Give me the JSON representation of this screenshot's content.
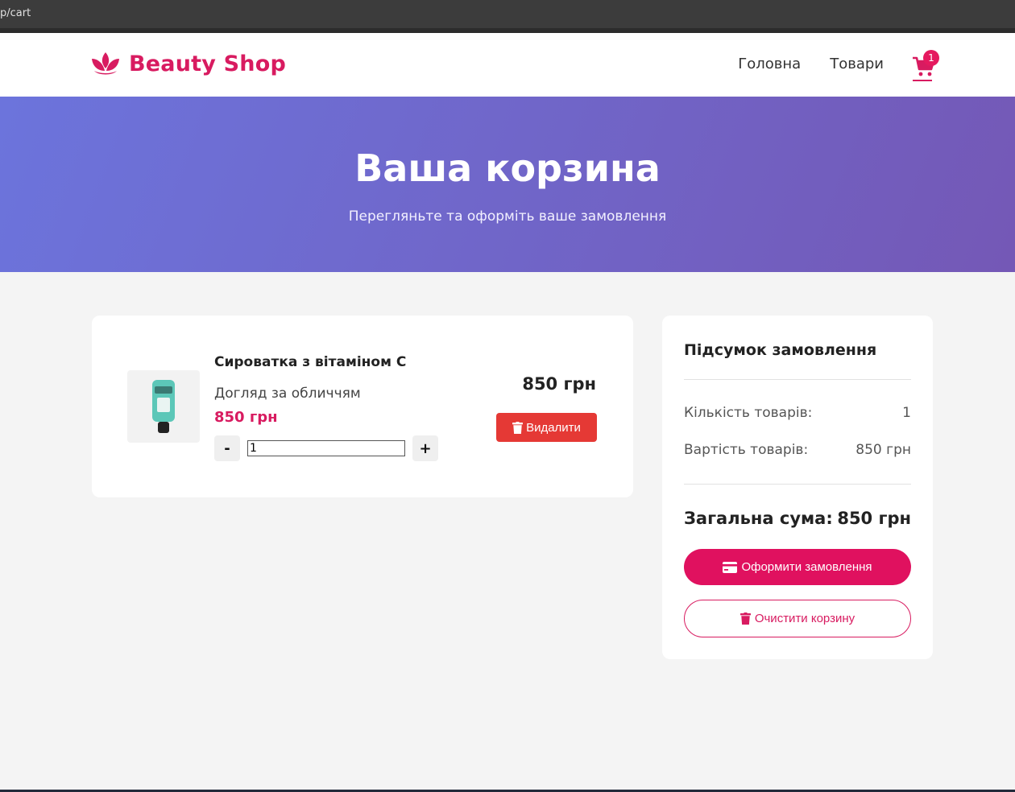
{
  "browser": {
    "url": "p/cart"
  },
  "header": {
    "brand": "Beauty Shop",
    "nav": [
      {
        "label": "Головна"
      },
      {
        "label": "Товари"
      }
    ],
    "cart_count": "1",
    "brand_color": "#d81b60"
  },
  "hero": {
    "title": "Ваша корзина",
    "subtitle": "Перегляньте та оформіть ваше замовлення"
  },
  "cart": {
    "items": [
      {
        "name": "Сироватка з вітаміном C",
        "category": "Догляд за обличчям",
        "price": "850 грн",
        "quantity": "1",
        "line_total": "850 грн",
        "decrease_label": "-",
        "increase_label": "+",
        "remove_label": "Видалити"
      }
    ]
  },
  "summary": {
    "title": "Підсумок замовлення",
    "count_label": "Кількість товарів:",
    "count_value": "1",
    "cost_label": "Вартість товарів:",
    "cost_value": "850 грн",
    "total_label": "Загальна сума:",
    "total_value": "850 грн",
    "checkout_label": "Оформити замовлення",
    "clear_label": "Очистити корзину"
  },
  "colors": {
    "accent": "#d81b60",
    "remove": "#e53935",
    "hero_start": "#6c74dc",
    "hero_end": "#7458b6"
  }
}
